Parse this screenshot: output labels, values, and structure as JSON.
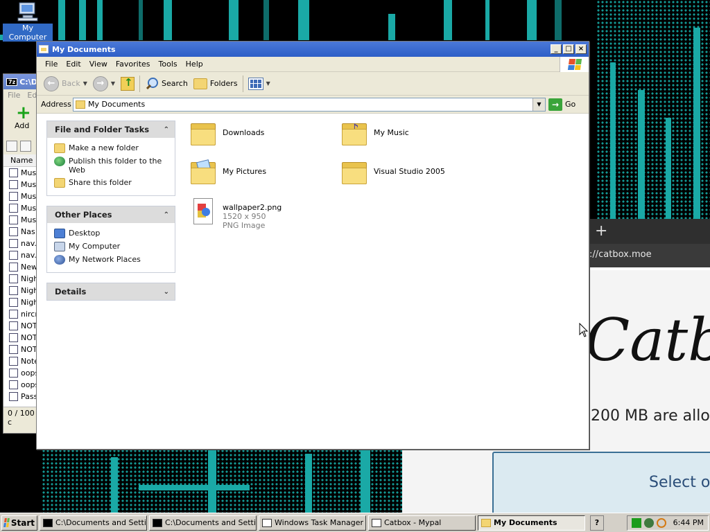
{
  "desktop": {
    "icon_label": "My Computer"
  },
  "zip_window": {
    "title": "C:\\D",
    "badge": "7z",
    "menu": [
      "File",
      "Ed"
    ],
    "add_label": "Add",
    "column_name": "Name",
    "rows": [
      "Mus",
      "Mus",
      "Mus",
      "Mus",
      "Mus",
      "Nas",
      "nav.",
      "nav.",
      "New",
      "Nigh",
      "Nigh",
      "Nigh",
      "nircr",
      "NOT",
      "NOT",
      "NOT",
      "Note",
      "oops",
      "oops",
      "Pass"
    ],
    "status": "0 / 100 c"
  },
  "browser": {
    "url": "://catbox.moe",
    "heading": "Catbo",
    "limit_text": "200 MB are allo",
    "select_text": "Select o"
  },
  "explorer": {
    "title": "My Documents",
    "menu": [
      "File",
      "Edit",
      "View",
      "Favorites",
      "Tools",
      "Help"
    ],
    "toolbar": {
      "back": "Back",
      "search": "Search",
      "folders": "Folders"
    },
    "address_label": "Address",
    "address_value": "My Documents",
    "go_label": "Go",
    "panels": {
      "tasks": {
        "title": "File and Folder Tasks",
        "items": [
          "Make a new folder",
          "Publish this folder to the Web",
          "Share this folder"
        ]
      },
      "places": {
        "title": "Other Places",
        "items": [
          "Desktop",
          "My Computer",
          "My Network Places"
        ]
      },
      "details": {
        "title": "Details"
      }
    },
    "files": [
      {
        "name": "Downloads"
      },
      {
        "name": "My Music"
      },
      {
        "name": "My Pictures"
      },
      {
        "name": "Visual Studio 2005"
      },
      {
        "name": "wallpaper2.png",
        "dimensions": "1520 x 950",
        "type": "PNG Image"
      }
    ]
  },
  "taskbar": {
    "start": "Start",
    "buttons": [
      "C:\\Documents and Setti...",
      "C:\\Documents and Setti...",
      "Windows Task Manager",
      "Catbox - Mypal",
      "My Documents"
    ],
    "clock": "6:44 PM"
  },
  "colors": {
    "titlebar": "#2d5ec7",
    "teal": "#1aa9a6",
    "selection": "#316ac5"
  }
}
